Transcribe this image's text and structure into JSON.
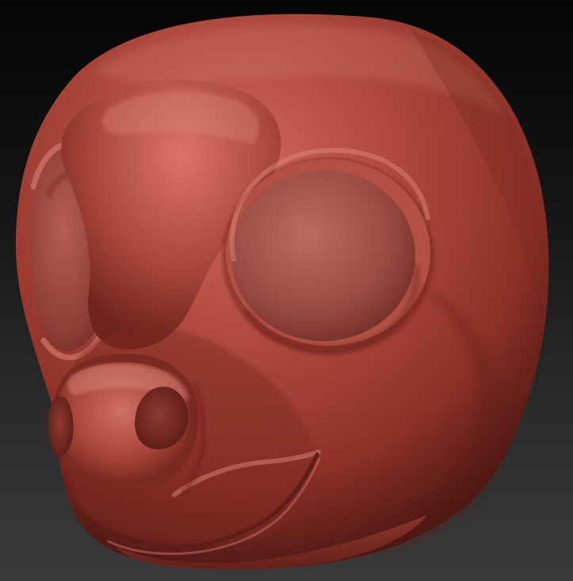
{
  "scene": {
    "colors": {
      "background_top": "#050505",
      "background_bottom": "#3a3a3a",
      "clay_base": "#9b3b2f",
      "clay_highlight": "#d06a5e",
      "clay_shadow": "#4c1712",
      "eye_socket": "#a8574f",
      "nostril": "#7a2d25",
      "mouth_line": "#5d1e18"
    },
    "icons": {
      "model": "sculpted-head-icon"
    }
  }
}
